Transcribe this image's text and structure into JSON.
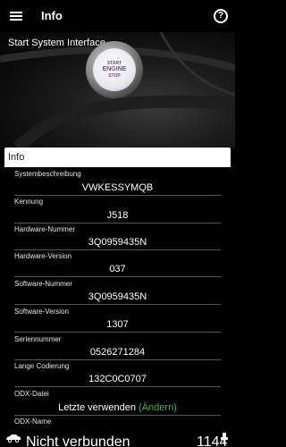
{
  "app": {
    "title": "Info"
  },
  "hero": {
    "title": "Start System Interface",
    "button_lines": [
      "START",
      "ENGINE",
      "STOP"
    ]
  },
  "panel": {
    "header": "Info",
    "fields": [
      {
        "label": "Systembeschreibung",
        "value": "VWKESSYMQB"
      },
      {
        "label": "Kennung",
        "value": "J518"
      },
      {
        "label": "Hardware-Nummer",
        "value": "3Q0959435N"
      },
      {
        "label": "Hardware-Version",
        "value": "037"
      },
      {
        "label": "Software-Nummer",
        "value": "3Q0959435N"
      },
      {
        "label": "Software-Version",
        "value": "1307"
      },
      {
        "label": "Seriennummer",
        "value": "0526271284"
      },
      {
        "label": "Lange Codierung",
        "value": "132C0C0707"
      },
      {
        "label": "ODX-Datei",
        "value": "Letzte verwenden",
        "action": "(Ändern)"
      },
      {
        "label": "ODX-Name",
        "value": ""
      }
    ]
  },
  "status": {
    "connection": "Nicht verbunden",
    "count": "1144"
  },
  "colors": {
    "accent_green": "#2fbf3a",
    "header_bg": "#ffffff"
  },
  "icons": [
    "menu-icon",
    "help-icon",
    "car-icon",
    "connector-icon"
  ]
}
